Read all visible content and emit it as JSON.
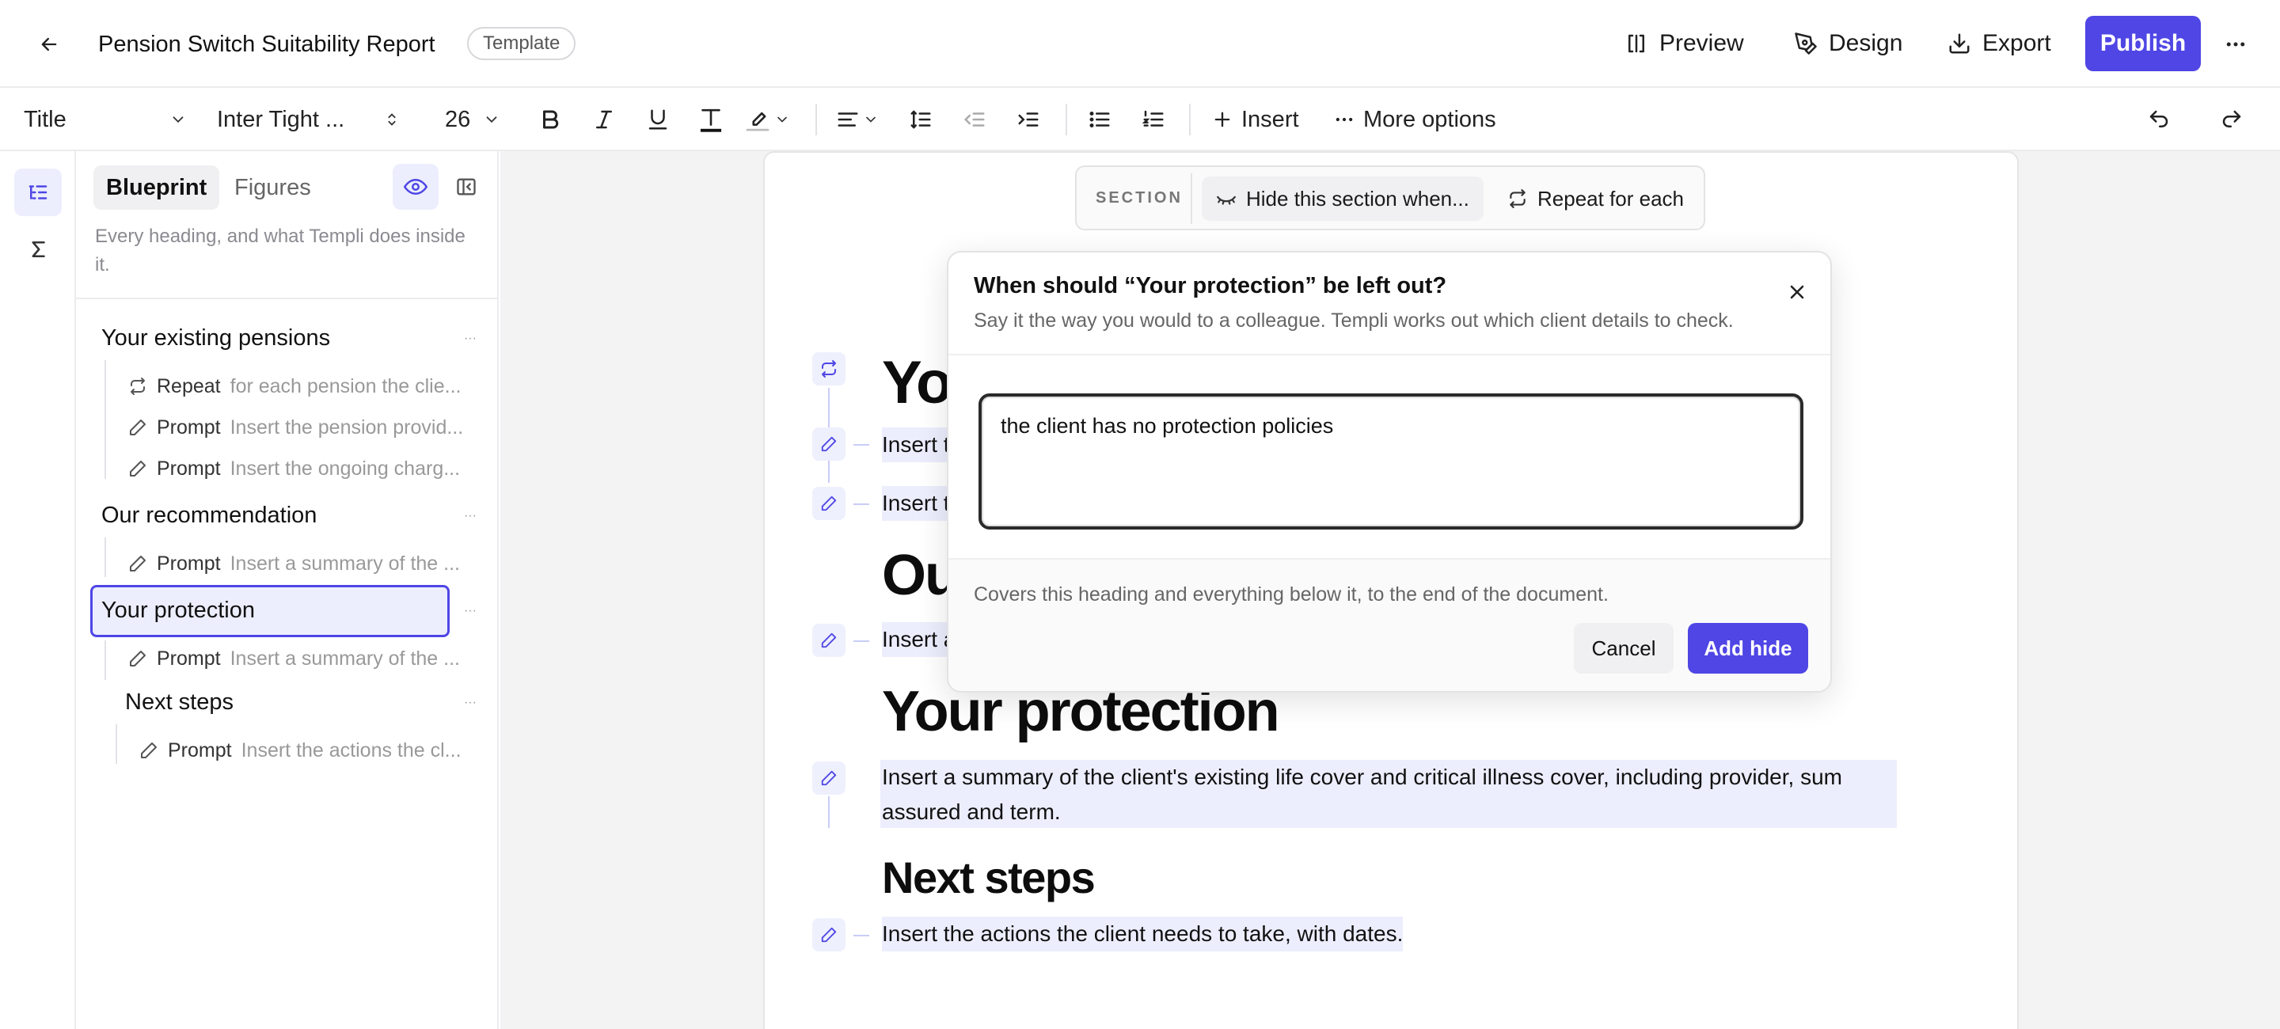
{
  "header": {
    "doc_title": "Pension Switch Suitability Report",
    "badge": "Template",
    "preview_label": "Preview",
    "design_label": "Design",
    "export_label": "Export",
    "publish_label": "Publish"
  },
  "toolbar": {
    "style_value": "Title",
    "font_value": "Inter Tight ...",
    "size_value": "26",
    "insert_label": "Insert",
    "more_label": "More options"
  },
  "panel": {
    "tab_blueprint": "Blueprint",
    "tab_figures": "Figures",
    "description": "Every heading, and what Templi does inside it.",
    "sections": [
      {
        "heading": "Your existing pensions",
        "rows": [
          {
            "kind": "Repeat",
            "desc": "for each pension the clie..."
          },
          {
            "kind": "Prompt",
            "desc": "Insert the pension provid..."
          },
          {
            "kind": "Prompt",
            "desc": "Insert the ongoing charg..."
          }
        ]
      },
      {
        "heading": "Our recommendation",
        "rows": [
          {
            "kind": "Prompt",
            "desc": "Insert a summary of the ..."
          }
        ]
      },
      {
        "heading": "Your protection",
        "rows": [
          {
            "kind": "Prompt",
            "desc": "Insert a summary of the ..."
          }
        ]
      },
      {
        "heading": "Next steps",
        "rows": [
          {
            "kind": "Prompt",
            "desc": "Insert the actions the cl..."
          }
        ]
      }
    ]
  },
  "section_bar": {
    "label": "SECTION",
    "hide_label": "Hide this section when...",
    "repeat_label": "Repeat for each"
  },
  "document": {
    "h1_partial": "You",
    "p1_partial": "Insert t",
    "p2_partial": "Insert t",
    "h2_partial": "Ou",
    "p3_partial": "Insert a",
    "h3": "Your protection",
    "p4": "Insert a summary of the client's existing life cover and critical illness cover, including provider, sum assured and term.",
    "h4": "Next steps",
    "p5": "Insert the actions the client needs to take, with dates."
  },
  "dialog": {
    "title": "When should “Your protection” be left out?",
    "subtitle": "Say it the way you would to a colleague. Templi works out which client details to check.",
    "input_value": "the client has no protection policies",
    "note": "Covers this heading and everything below it, to the end of the document.",
    "cancel_label": "Cancel",
    "add_label": "Add hide"
  },
  "colors": {
    "accent": "#4f46e5",
    "highlight": "#eceefd",
    "canvas_bg": "#f3f3f4"
  }
}
